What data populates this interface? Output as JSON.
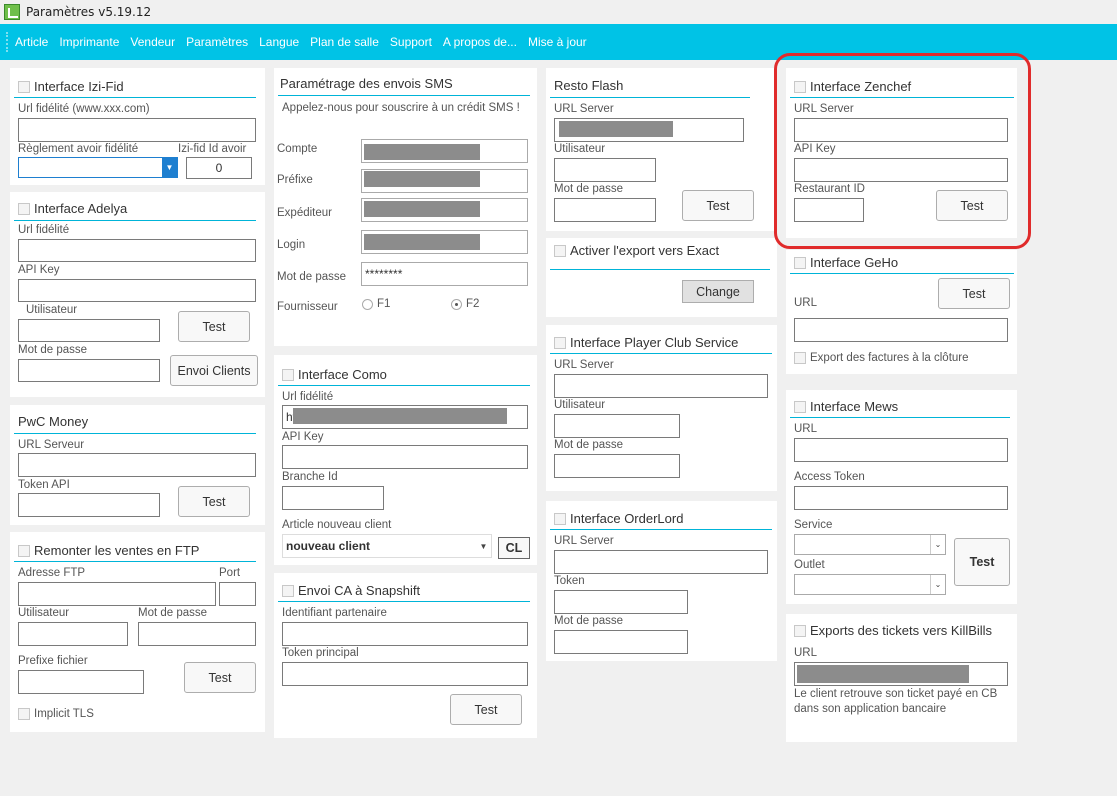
{
  "window": {
    "title": "Paramètres v5.19.12"
  },
  "menu": [
    "Article",
    "Imprimante",
    "Vendeur",
    "Paramètres",
    "Langue",
    "Plan de salle",
    "Support",
    "A propos de...",
    "Mise à jour"
  ],
  "izifid": {
    "title": "Interface Izi-Fid",
    "url_label": "Url fidélité (www.xxx.com)",
    "reglement_label": "Règlement avoir fidélité",
    "id_avoir_label": "Izi-fid Id avoir",
    "id_avoir_value": "0"
  },
  "adelya": {
    "title": "Interface Adelya",
    "url_label": "Url fidélité",
    "apikey_label": "API Key",
    "user_label": "Utilisateur",
    "password_label": "Mot de passe",
    "test": "Test",
    "envoi": "Envoi Clients"
  },
  "pwc": {
    "title": "PwC Money",
    "url_label": "URL Serveur",
    "token_label": "Token API",
    "test": "Test"
  },
  "ftp": {
    "title": "Remonter les ventes en FTP",
    "address_label": "Adresse FTP",
    "port_label": "Port",
    "user_label": "Utilisateur",
    "password_label": "Mot de passe",
    "prefix_label": "Prefixe fichier",
    "test": "Test",
    "tls_label": "Implicit TLS"
  },
  "sms": {
    "title": "Paramétrage des envois SMS",
    "subtitle": "Appelez-nous pour souscrire à un crédit SMS !",
    "compte_label": "Compte",
    "prefixe_label": "Préfixe",
    "expediteur_label": "Expéditeur",
    "login_label": "Login",
    "password_label": "Mot de passe",
    "password_value": "********",
    "fournisseur_label": "Fournisseur",
    "f1": "F1",
    "f2": "F2",
    "selected": "F2"
  },
  "como": {
    "title": "Interface Como",
    "url_label": "Url fidélité",
    "url_value": "ht",
    "apikey_label": "API Key",
    "branch_label": "Branche Id",
    "article_label": "Article nouveau client",
    "article_value": "nouveau client",
    "cl": "CL"
  },
  "snapshift": {
    "title": "Envoi CA à Snapshift",
    "partner_label": "Identifiant partenaire",
    "token_label": "Token principal",
    "test": "Test"
  },
  "restoflash": {
    "title": "Resto Flash",
    "url_label": "URL Server",
    "user_label": "Utilisateur",
    "password_label": "Mot de passe",
    "test": "Test"
  },
  "exact": {
    "title": "Activer l'export vers Exact",
    "change": "Change"
  },
  "playerclub": {
    "title": "Interface Player Club Service",
    "url_label": "URL Server",
    "user_label": "Utilisateur",
    "password_label": "Mot de passe"
  },
  "orderlord": {
    "title": "Interface OrderLord",
    "url_label": "URL Server",
    "token_label": "Token",
    "password_label": "Mot de passe"
  },
  "zenchef": {
    "title": "Interface Zenchef",
    "url_label": "URL Server",
    "apikey_label": "API Key",
    "restaurant_label": "Restaurant ID",
    "test": "Test"
  },
  "geho": {
    "title": "Interface GeHo",
    "url_label": "URL",
    "test": "Test",
    "export_label": "Export des factures à la clôture"
  },
  "mews": {
    "title": "Interface Mews",
    "url_label": "URL",
    "token_label": "Access Token",
    "service_label": "Service",
    "outlet_label": "Outlet",
    "test": "Test"
  },
  "killbills": {
    "title": "Exports des tickets vers KillBills",
    "url_label": "URL",
    "note": "Le client retrouve son ticket payé en CB dans son application bancaire"
  },
  "colors": {
    "accent": "#00c3e6",
    "underline": "#00b4d8",
    "highlight": "#e02b2b"
  }
}
